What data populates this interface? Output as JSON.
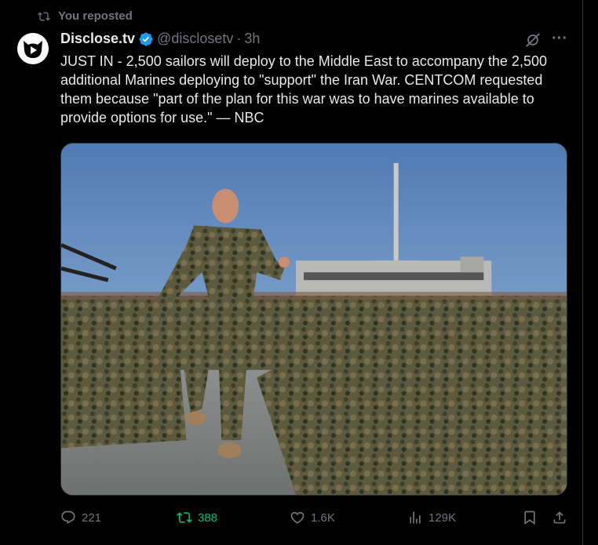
{
  "repost_banner": {
    "text": "You reposted",
    "icon": "repost-icon"
  },
  "author": {
    "name": "Disclose.tv",
    "verified_icon": "verified-badge-icon",
    "handle": "@disclosetv",
    "separator": "·",
    "time": "3h",
    "avatar_icon": "disclose-logo-icon"
  },
  "header_icons": {
    "grok": "grok-icon",
    "more": "···"
  },
  "tweet": {
    "text": "JUST IN - 2,500 sailors will deploy to the Middle East to accompany the 2,500 additional Marines deploying to \"support\" the Iran War. CENTCOM requested them because \"part of the plan for this war was to have marines available to provide options for use.\" — NBC"
  },
  "media": {
    "icon": "photo"
  },
  "actions": {
    "replies": "221",
    "reposts": "388",
    "likes": "1.6K",
    "views": "129K"
  },
  "colors": {
    "accent_blue": "#1d9bf0",
    "repost_green": "#00ba7c",
    "muted": "#71767b"
  }
}
